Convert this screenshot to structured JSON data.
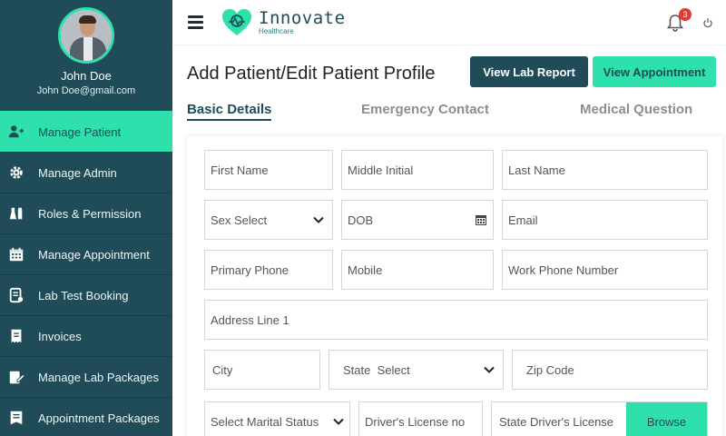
{
  "user": {
    "name": "John Doe",
    "email": "John Doe@gmail.com"
  },
  "menu": [
    {
      "label": "Manage Patient",
      "icon": "add-user-icon",
      "active": true
    },
    {
      "label": "Manage Admin",
      "icon": "gear-icon",
      "active": false
    },
    {
      "label": "Roles & Permission",
      "icon": "flask-icon",
      "active": false
    },
    {
      "label": "Manage Appointment",
      "icon": "calendar-icon",
      "active": false
    },
    {
      "label": "Lab Test Booking",
      "icon": "document-icon",
      "active": false
    },
    {
      "label": "Invoices",
      "icon": "invoice-icon",
      "active": false
    },
    {
      "label": "Manage Lab Packages",
      "icon": "edit-icon",
      "active": false
    },
    {
      "label": "Appointment Packages",
      "icon": "list-icon",
      "active": false
    }
  ],
  "header": {
    "logo_title": "Innovate",
    "logo_subtitle": "Healthcare",
    "notification_count": "3"
  },
  "page": {
    "title": "Add Patient/Edit Patient Profile",
    "view_lab_report": "View Lab Report",
    "view_appointment": "View Appointment"
  },
  "tabs": [
    "Basic Details",
    "Emergency Contact",
    "Medical Question"
  ],
  "form": {
    "first_name": "First Name",
    "middle_initial": "Middle Initial",
    "last_name": "Last Name",
    "sex_select": "Sex Select",
    "dob": "DOB",
    "email": "Email",
    "primary_phone": "Primary Phone",
    "mobile": "Mobile",
    "work_phone": "Work Phone Number",
    "address_line_1": "Address Line 1",
    "city": "City",
    "state_select": "State  Select",
    "zip_code": "Zip Code",
    "marital_status": "Select Marital Status",
    "drivers_license": "Driver's License no",
    "state_drivers_license": "State Driver's License",
    "browse": "Browse"
  },
  "colors": {
    "primary": "#1f4c58",
    "accent": "#2ee0ab",
    "badge": "#e53935"
  }
}
